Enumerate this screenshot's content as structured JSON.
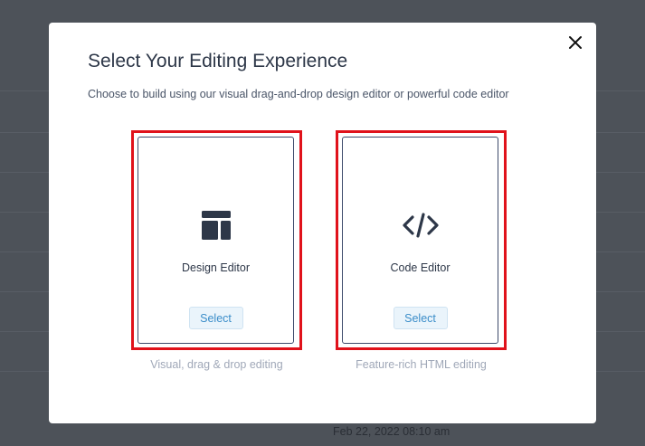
{
  "background": {
    "timestamp": "Feb 22, 2022 08:10 am"
  },
  "modal": {
    "title": "Select Your Editing Experience",
    "subtitle": "Choose to build using our visual drag-and-drop design editor or powerful code editor",
    "close_icon": "close-icon",
    "options": [
      {
        "icon": "layout-icon",
        "label": "Design Editor",
        "button": "Select",
        "caption": "Visual, drag & drop editing"
      },
      {
        "icon": "code-icon",
        "label": "Code Editor",
        "button": "Select",
        "caption": "Feature-rich HTML editing"
      }
    ]
  },
  "colors": {
    "highlight": "#e0121b",
    "card_border": "#3d4a6b",
    "icon": "#2d3748",
    "button_text": "#3b8dc9",
    "button_bg": "#eaf4fb",
    "caption": "#a0a8b8",
    "overlay": "#4d5259"
  }
}
